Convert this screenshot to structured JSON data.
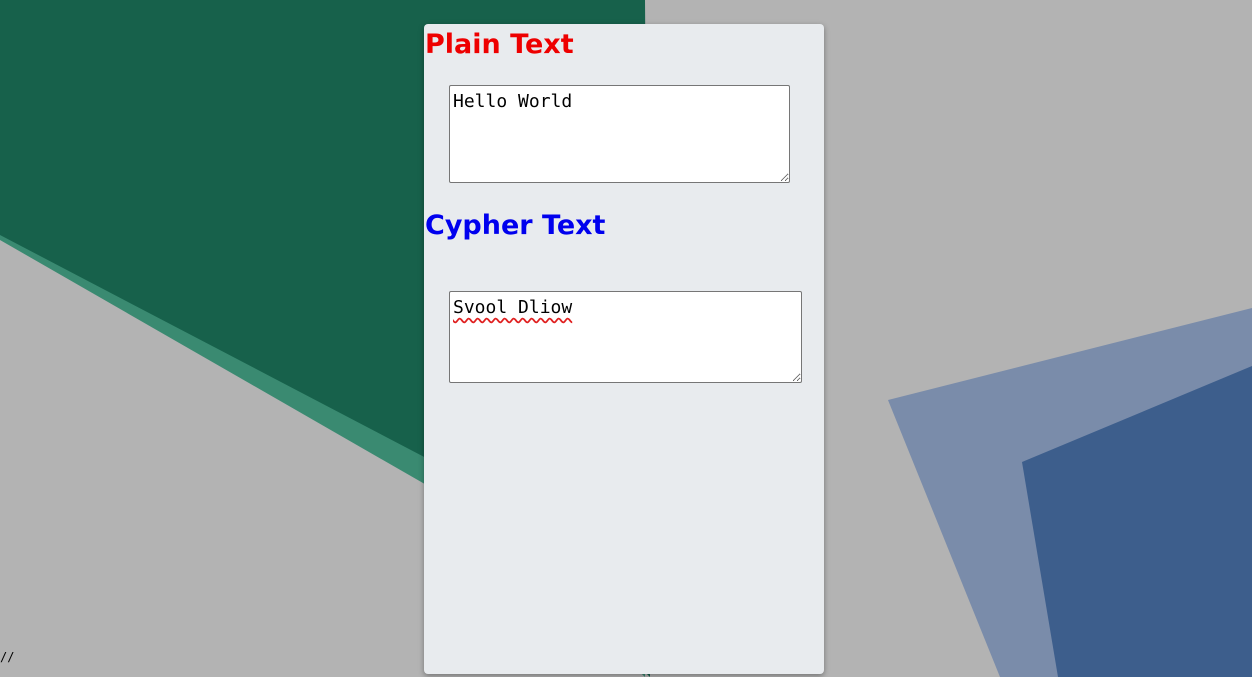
{
  "plain_section": {
    "heading": "Plain Text",
    "heading_color": "#ee0000",
    "input_value": "Hello World"
  },
  "cypher_section": {
    "heading": "Cypher Text",
    "heading_color": "#0000ee",
    "input_value": "Svool Dliow"
  },
  "corner_mark": "//",
  "colors": {
    "background": "#b3b3b3",
    "card": "#e8ebee",
    "green_dark": "#17614b",
    "green_light": "#3a8a71",
    "blue_light": "#7a8caa",
    "blue_dark": "#3d5e8c"
  }
}
